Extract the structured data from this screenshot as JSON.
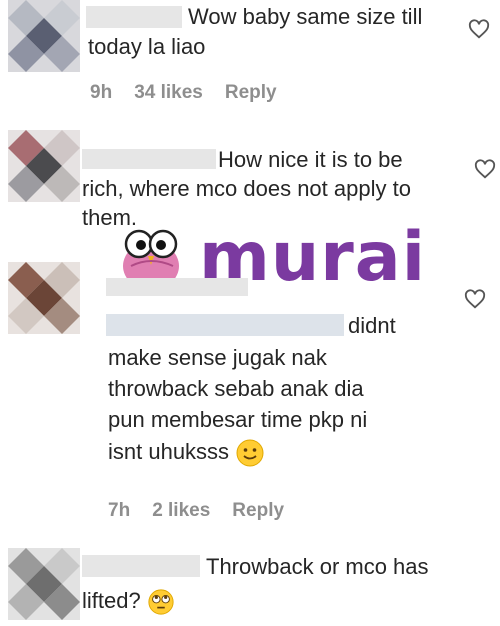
{
  "comments": [
    {
      "username": "",
      "text": "Wow baby same size till today la liao",
      "line1": "Wow baby same size till",
      "line2": "today la liao",
      "time": "9h",
      "likes": "34 likes",
      "reply": "Reply"
    },
    {
      "username": "",
      "line1": "How nice it is to be",
      "line2": "rich, where mco does not apply to",
      "line3": "them."
    },
    {
      "username": "",
      "line1": "didnt",
      "line2": "make sense jugak nak",
      "line3": "throwback sebab anak dia",
      "line4": "pun membesar time pkp ni",
      "line5": "isnt uhuksss",
      "time": "7h",
      "likes": "2 likes",
      "reply": "Reply"
    },
    {
      "username": "",
      "line1": "Throwback or mco has",
      "line2": "lifted?"
    }
  ],
  "watermark": {
    "text": "murai"
  },
  "icons": {
    "like": "heart-outline-icon",
    "emoji_smile": "slightly-smiling-face-emoji",
    "emoji_eyeroll": "face-with-rolling-eyes-emoji",
    "logo_bird": "owl-bird-logo"
  },
  "colors": {
    "text": "#262626",
    "meta": "#8e8e8e",
    "logo": "#7b3aa0",
    "logo_pink": "#e07fb2"
  }
}
